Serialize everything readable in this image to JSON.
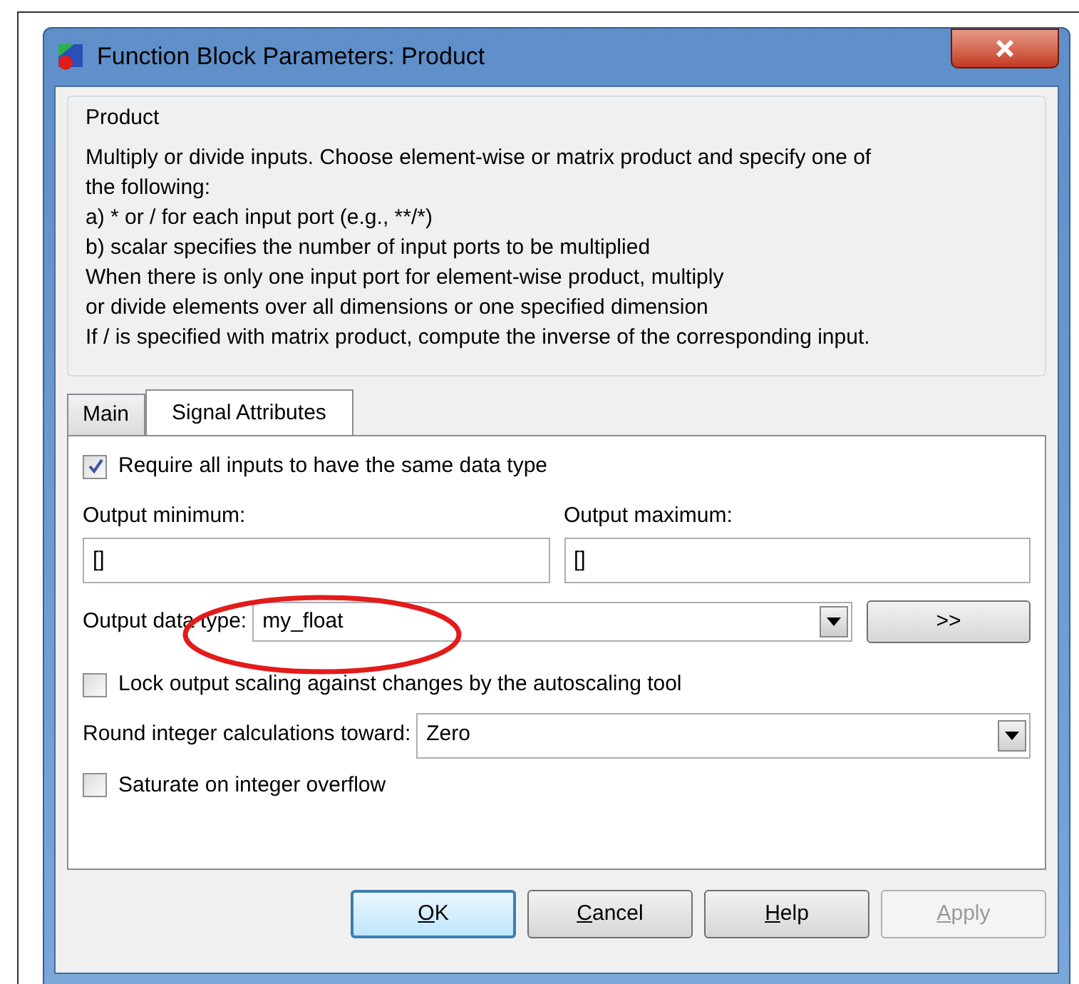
{
  "window": {
    "title": "Function Block Parameters: Product"
  },
  "description": {
    "title": "Product",
    "lines": [
      "Multiply or divide inputs.  Choose element-wise or matrix product and specify one of",
      "the following:",
      "a) * or / for each input port (e.g., **/*)",
      "b) scalar specifies the number of input ports to be multiplied",
      "When there is only one input port for element-wise product, multiply",
      "or divide elements over all dimensions or one specified dimension",
      "If / is specified with matrix product, compute the inverse of the corresponding input."
    ]
  },
  "tabs": [
    {
      "label": "Main",
      "selected": false
    },
    {
      "label": "Signal Attributes",
      "selected": true
    }
  ],
  "require_same_type": {
    "label": "Require all inputs to have the same data type",
    "checked": true
  },
  "output_minimum": {
    "label": "Output minimum:",
    "value": "[]"
  },
  "output_maximum": {
    "label": "Output maximum:",
    "value": "[]"
  },
  "output_data_type": {
    "label": "Output data type:",
    "value": "my_float",
    "button": ">>",
    "highlighted": true
  },
  "lock_scaling": {
    "label": "Lock output scaling against changes by the autoscaling tool",
    "checked": false
  },
  "round_toward": {
    "label": "Round integer calculations toward:",
    "value": "Zero"
  },
  "saturate": {
    "label": "Saturate on integer overflow",
    "checked": false
  },
  "buttons": [
    {
      "mnemonic": "O",
      "rest": "K",
      "default": true,
      "disabled": false
    },
    {
      "mnemonic": "C",
      "rest": "ancel",
      "default": false,
      "disabled": false
    },
    {
      "mnemonic": "H",
      "rest": "elp",
      "default": false,
      "disabled": false
    },
    {
      "mnemonic": "A",
      "rest": "pply",
      "default": false,
      "disabled": true
    }
  ]
}
